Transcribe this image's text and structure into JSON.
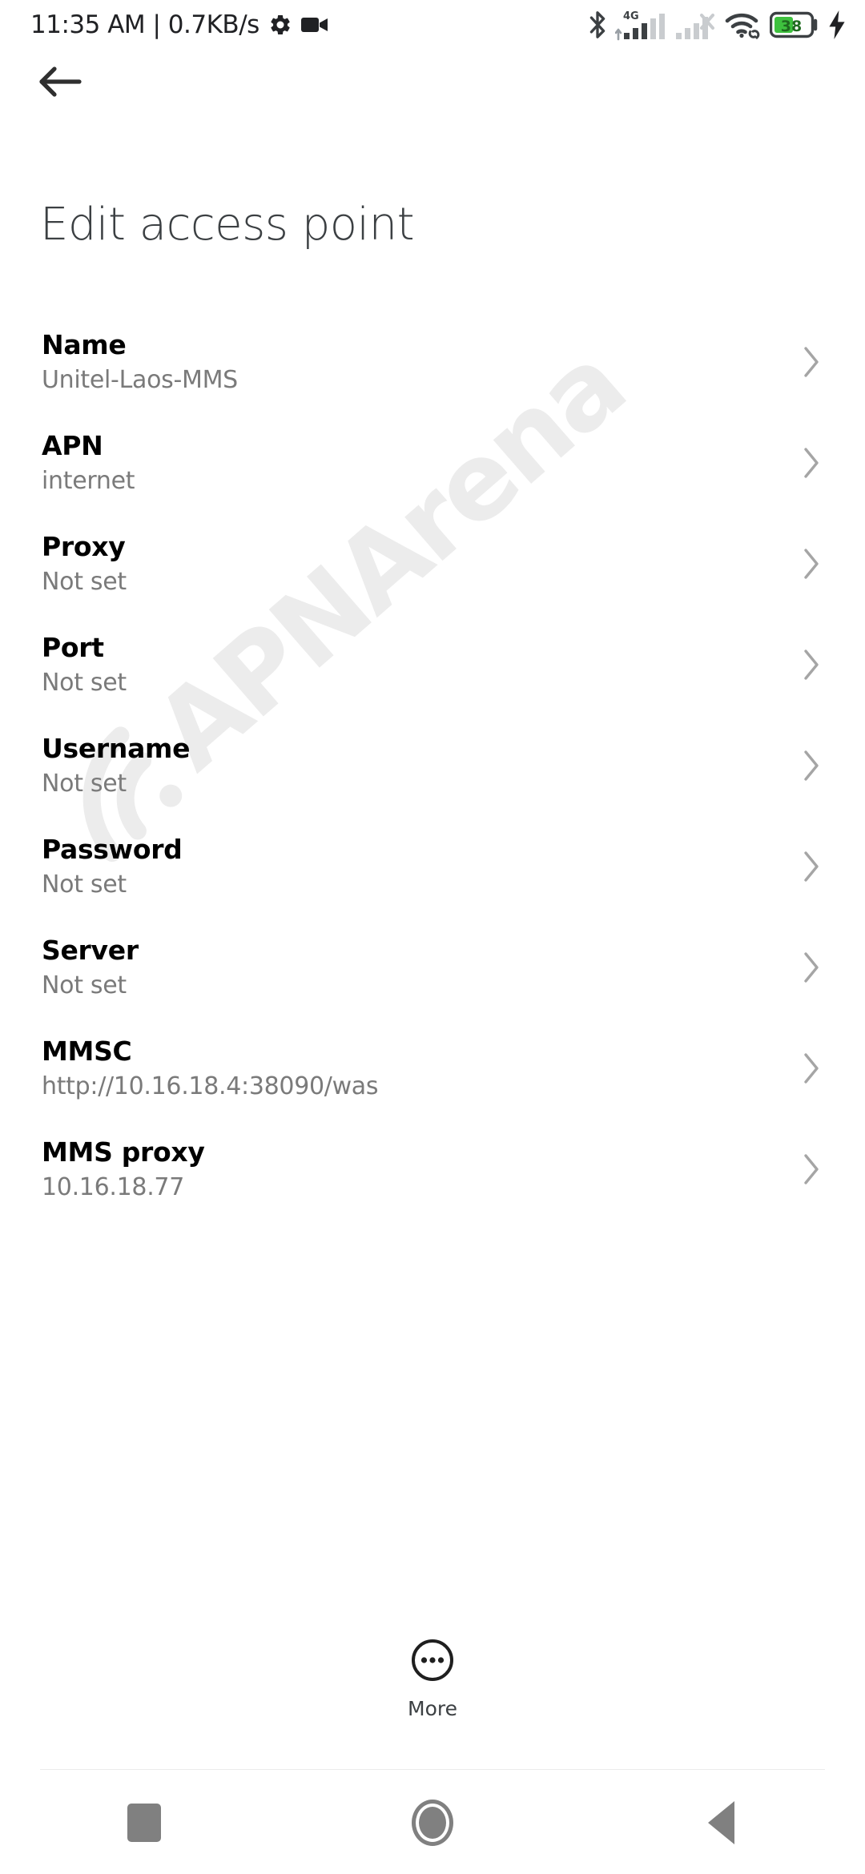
{
  "status_bar": {
    "clock_text": "11:35 AM | 0.7KB/s",
    "icons_left": [
      "gear-icon",
      "video-camera-icon"
    ],
    "icons_right": [
      "bluetooth-icon",
      "signal-4g-icon",
      "signal-no-service-icon",
      "wifi-icon",
      "battery-icon",
      "charging-bolt-icon"
    ],
    "network_type": "4G",
    "battery_percent": "38",
    "battery_color": "#3ec13e"
  },
  "header": {
    "back_icon": "arrow-left-icon",
    "title": "Edit access point"
  },
  "list": {
    "chevron_icon": "chevron-right-icon",
    "rows": [
      {
        "title": "Name",
        "value": "Unitel-Laos-MMS"
      },
      {
        "title": "APN",
        "value": "internet"
      },
      {
        "title": "Proxy",
        "value": "Not set"
      },
      {
        "title": "Port",
        "value": "Not set"
      },
      {
        "title": "Username",
        "value": "Not set"
      },
      {
        "title": "Password",
        "value": "Not set"
      },
      {
        "title": "Server",
        "value": "Not set"
      },
      {
        "title": "MMSC",
        "value": "http://10.16.18.4:38090/was"
      },
      {
        "title": "MMS proxy",
        "value": "10.16.18.77"
      }
    ]
  },
  "more_button": {
    "label": "More",
    "icon": "overflow-dots-circle-icon"
  },
  "nav_bar": {
    "recents_label": "Recents",
    "home_label": "Home",
    "back_label": "Back",
    "tint": "#808080"
  },
  "watermark": {
    "text": "APNArena",
    "icon": "wifi-arc-icon",
    "color": "#ececec"
  }
}
